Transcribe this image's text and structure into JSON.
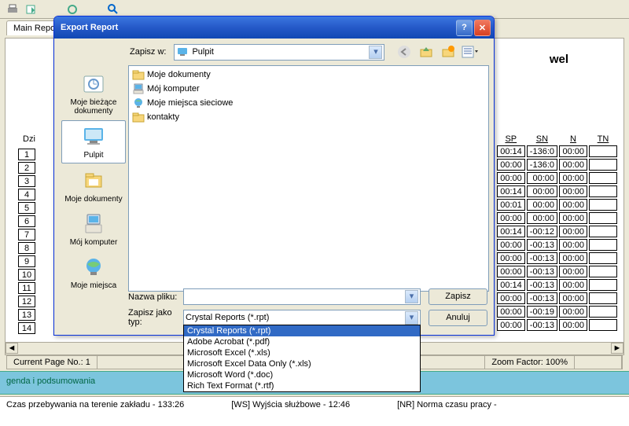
{
  "tabs": {
    "main": "Main Repo"
  },
  "bg": {
    "title_suffix": "wel",
    "dzi_label": "Dzi",
    "row_nums": [
      "1",
      "2",
      "3",
      "4",
      "5",
      "6",
      "7",
      "8",
      "9",
      "10",
      "11",
      "12",
      "13",
      "14"
    ],
    "right_headers": [
      "SP",
      "SN",
      "N",
      "TN"
    ],
    "right_rows": [
      [
        "00:14",
        "-136:0",
        "00:00",
        ""
      ],
      [
        "00:00",
        "-136:0",
        "00:00",
        ""
      ],
      [
        "00:00",
        "00:00",
        "00:00",
        ""
      ],
      [
        "00:14",
        "00:00",
        "00:00",
        ""
      ],
      [
        "00:01",
        "00:00",
        "00:00",
        ""
      ],
      [
        "00:00",
        "00:00",
        "00:00",
        ""
      ],
      [
        "00:14",
        "-00:12",
        "00:00",
        ""
      ],
      [
        "00:00",
        "-00:13",
        "00:00",
        ""
      ],
      [
        "00:00",
        "-00:13",
        "00:00",
        ""
      ],
      [
        "00:00",
        "-00:13",
        "00:00",
        ""
      ],
      [
        "00:14",
        "-00:13",
        "00:00",
        ""
      ],
      [
        "00:00",
        "-00:13",
        "00:00",
        ""
      ],
      [
        "00:00",
        "-00:19",
        "00:00",
        ""
      ],
      [
        "00:00",
        "-00:13",
        "00:00",
        ""
      ]
    ]
  },
  "status": {
    "page": "Current Page No.: 1",
    "zoom": "Zoom Factor: 100%"
  },
  "legend": "genda i podsumowania",
  "footer": {
    "a": "Czas przebywania na terenie zakładu - 133:26",
    "b": "[WS] Wyjścia służbowe - 12:46",
    "c": "[NR] Norma czasu pracy -"
  },
  "dialog": {
    "title": "Export Report",
    "save_in_label": "Zapisz w:",
    "save_in_value": "Pulpit",
    "sidebar": [
      {
        "label": "Moje bieżące dokumenty"
      },
      {
        "label": "Pulpit",
        "selected": true
      },
      {
        "label": "Moje dokumenty"
      },
      {
        "label": "Mój komputer"
      },
      {
        "label": "Moje miejsca"
      }
    ],
    "files": [
      {
        "name": "Moje dokumenty",
        "type": "folder"
      },
      {
        "name": "Mój komputer",
        "type": "computer"
      },
      {
        "name": "Moje miejsca sieciowe",
        "type": "network"
      },
      {
        "name": "kontakty",
        "type": "folder"
      }
    ],
    "filename_label": "Nazwa pliku:",
    "filename_value": "",
    "filetype_label": "Zapisz jako typ:",
    "filetype_value": "Crystal Reports (*.rpt)",
    "save_btn": "Zapisz",
    "cancel_btn": "Anuluj",
    "filetypes": [
      "Crystal Reports (*.rpt)",
      "Adobe Acrobat (*.pdf)",
      "Microsoft Excel (*.xls)",
      "Microsoft Excel Data Only (*.xls)",
      "Microsoft Word (*.doc)",
      "Rich Text Format (*.rtf)"
    ]
  }
}
